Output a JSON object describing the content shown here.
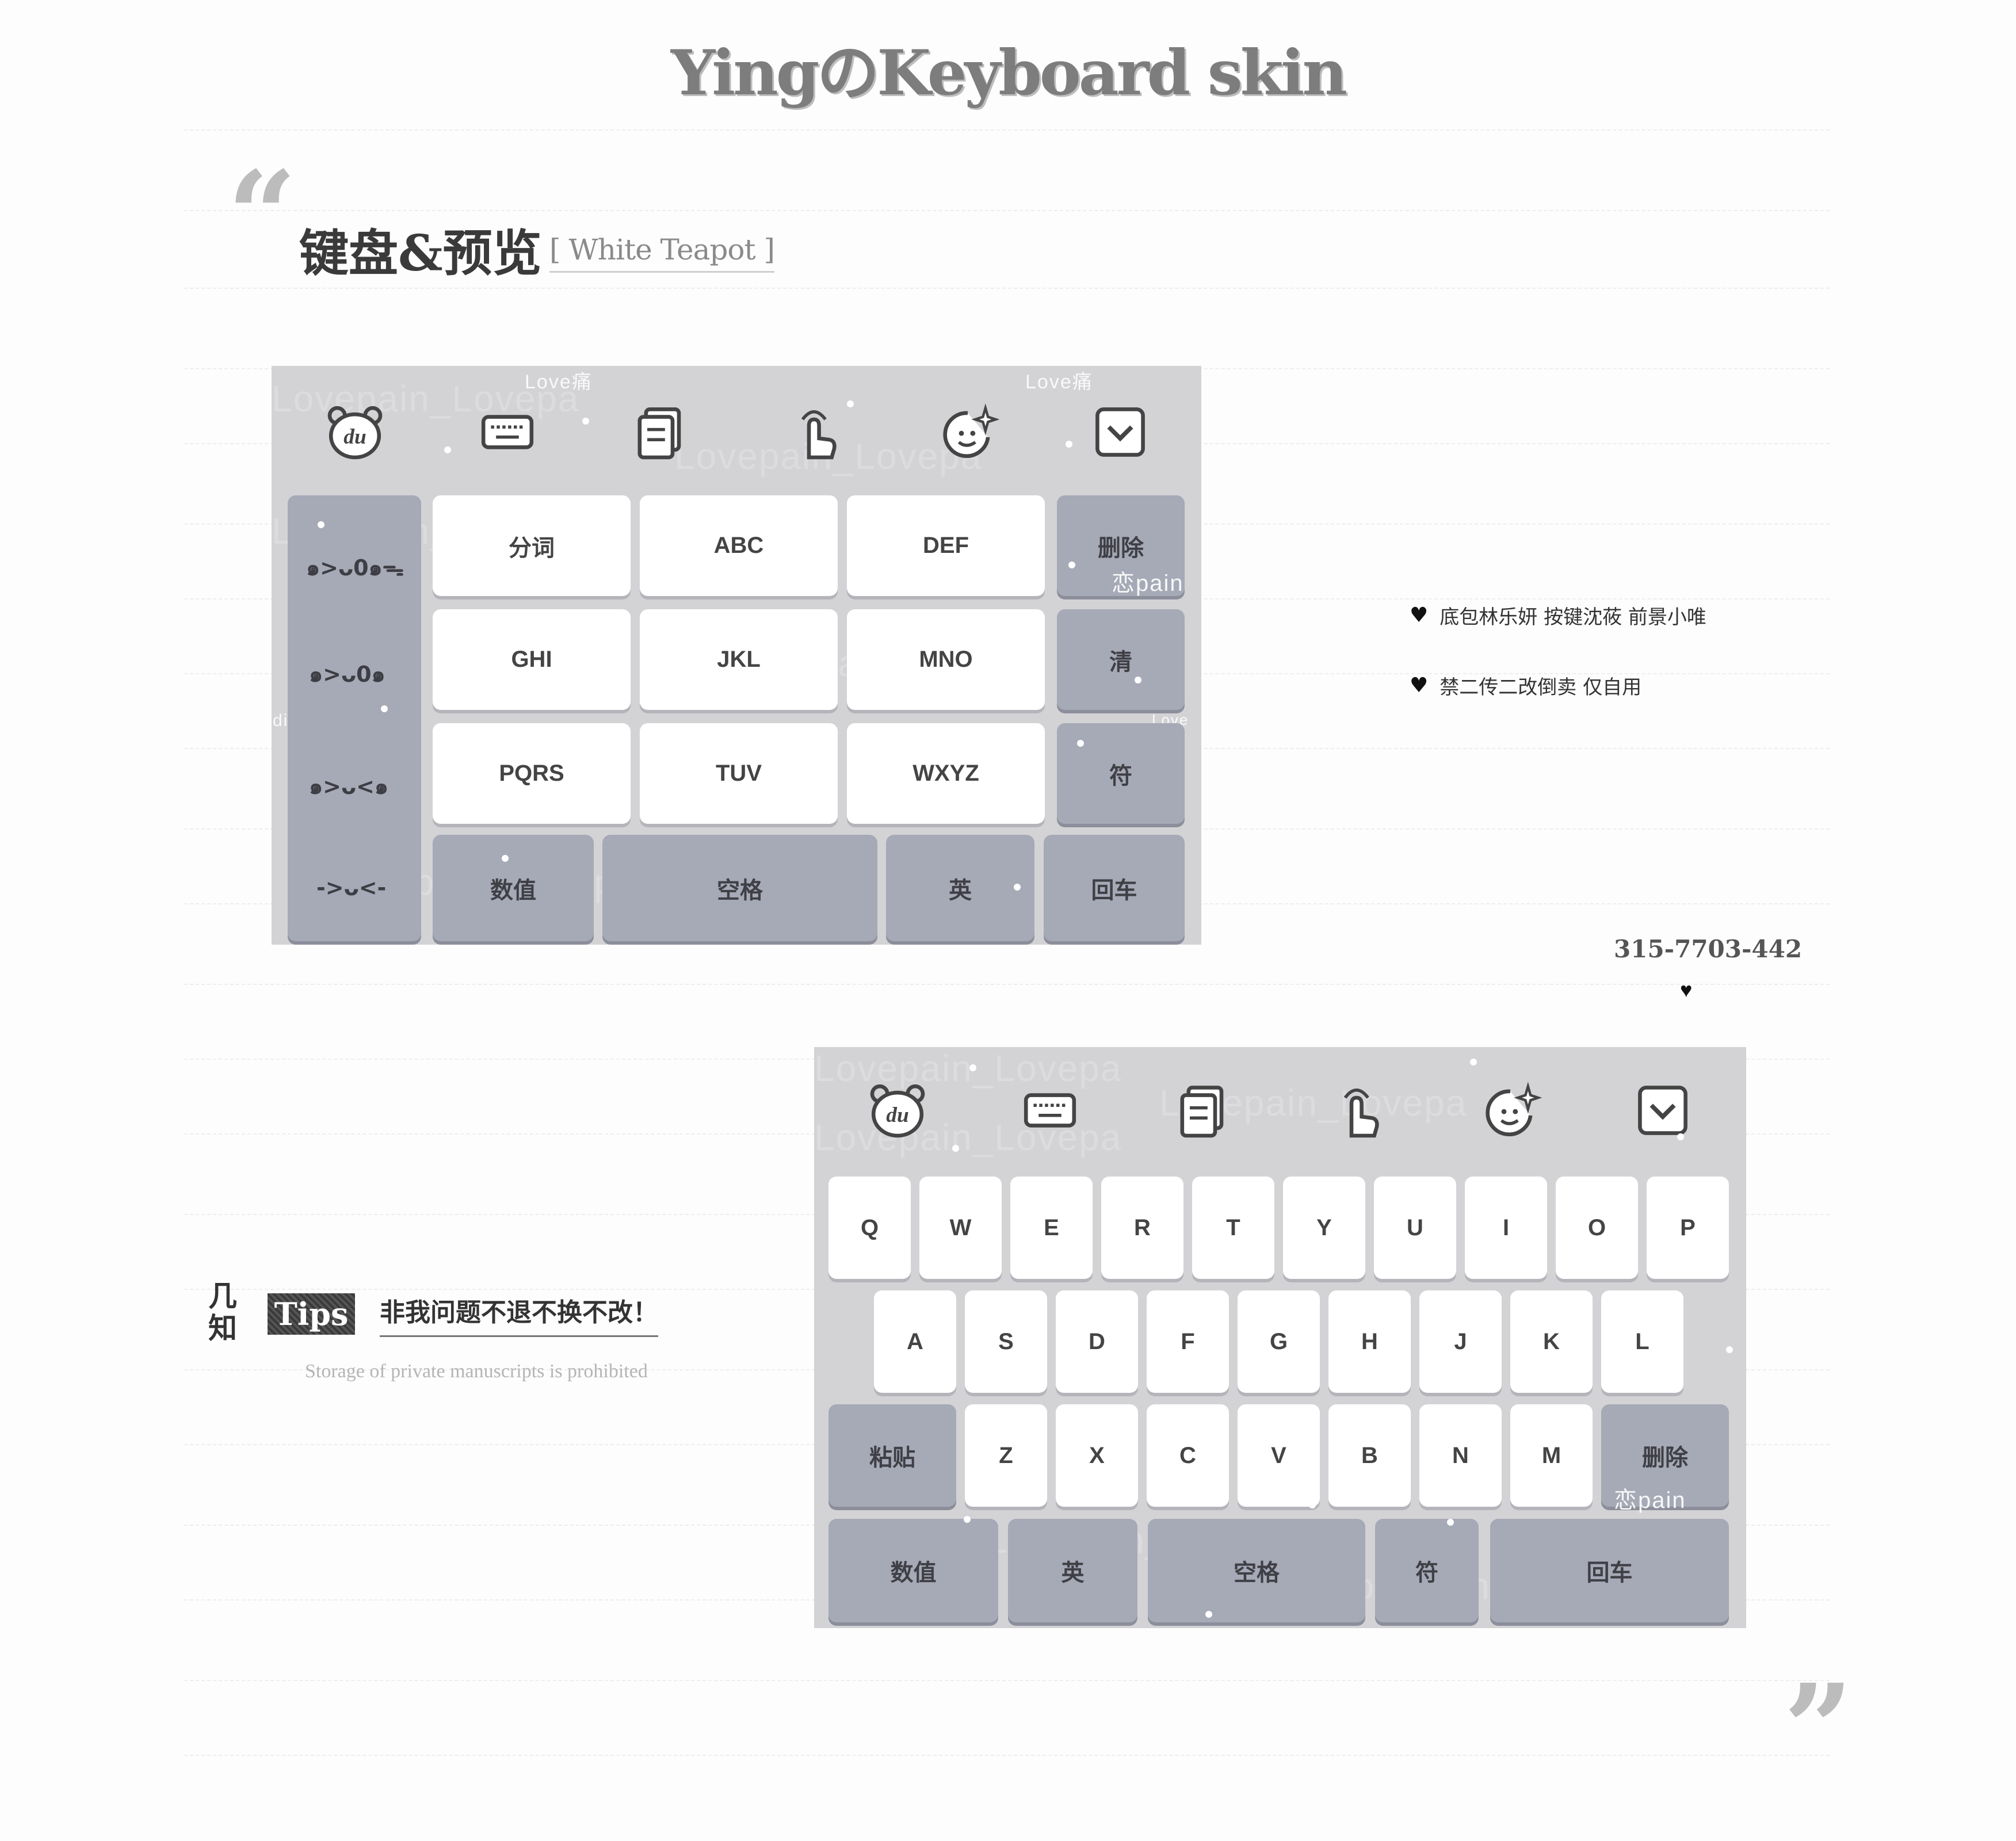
{
  "title": "YingのKeyboard skin",
  "section": {
    "heading": "键盘&预览",
    "subheading": "[ White Teapot ]"
  },
  "quotes": {
    "open": "“",
    "close": "”"
  },
  "keyboard9": {
    "toolbar_icons": [
      "du-bear-icon",
      "keyboard-icon",
      "clipboard-icon",
      "gesture-icon",
      "emoji-sparkle-icon",
      "collapse-icon"
    ],
    "emoticons": [
      "๑>ᴗ0๑ᯓ",
      "๑>ᴗ0๑",
      "๑>ᴗ<๑",
      "->ᴗ<-"
    ],
    "rows": [
      [
        "分词",
        "ABC",
        "DEF"
      ],
      [
        "GHI",
        "JKL",
        "MNO"
      ],
      [
        "PQRS",
        "TUV",
        "WXYZ"
      ]
    ],
    "side_keys": [
      "删除",
      "清",
      "符"
    ],
    "bottom_keys": [
      "数值",
      "空格",
      "英",
      "回车"
    ]
  },
  "info": {
    "credit": "底包林乐妍 按键沈莜 前景小唯",
    "notice": "禁二传二改倒卖 仅自用",
    "qq": "315-7703-442",
    "heart": "♥"
  },
  "tips": {
    "vertical": "几知",
    "badge": "Tips",
    "text": "非我问题不退不换不改！",
    "english": "Storage of private manuscripts is prohibited"
  },
  "keyboard26": {
    "toolbar_icons": [
      "du-bear-icon",
      "keyboard-icon",
      "clipboard-icon",
      "gesture-icon",
      "emoji-sparkle-icon",
      "collapse-icon"
    ],
    "row1": [
      "Q",
      "W",
      "E",
      "R",
      "T",
      "Y",
      "U",
      "I",
      "O",
      "P"
    ],
    "row2": [
      "A",
      "S",
      "D",
      "F",
      "G",
      "H",
      "J",
      "K",
      "L"
    ],
    "row3": [
      "Z",
      "X",
      "C",
      "V",
      "B",
      "N",
      "M"
    ],
    "paste": "粘贴",
    "delete": "删除",
    "bottom_keys": [
      "数值",
      "英",
      "空格",
      "符",
      "回车"
    ]
  },
  "watermarks": [
    "Love痛",
    "Lovepain_Lovepa",
    "恋pain",
    "disease",
    "Love"
  ],
  "colors": {
    "keyboard_bg": "#d3d3d6",
    "function_key": "#a6a9b6",
    "letter_key": "#ffffff"
  }
}
